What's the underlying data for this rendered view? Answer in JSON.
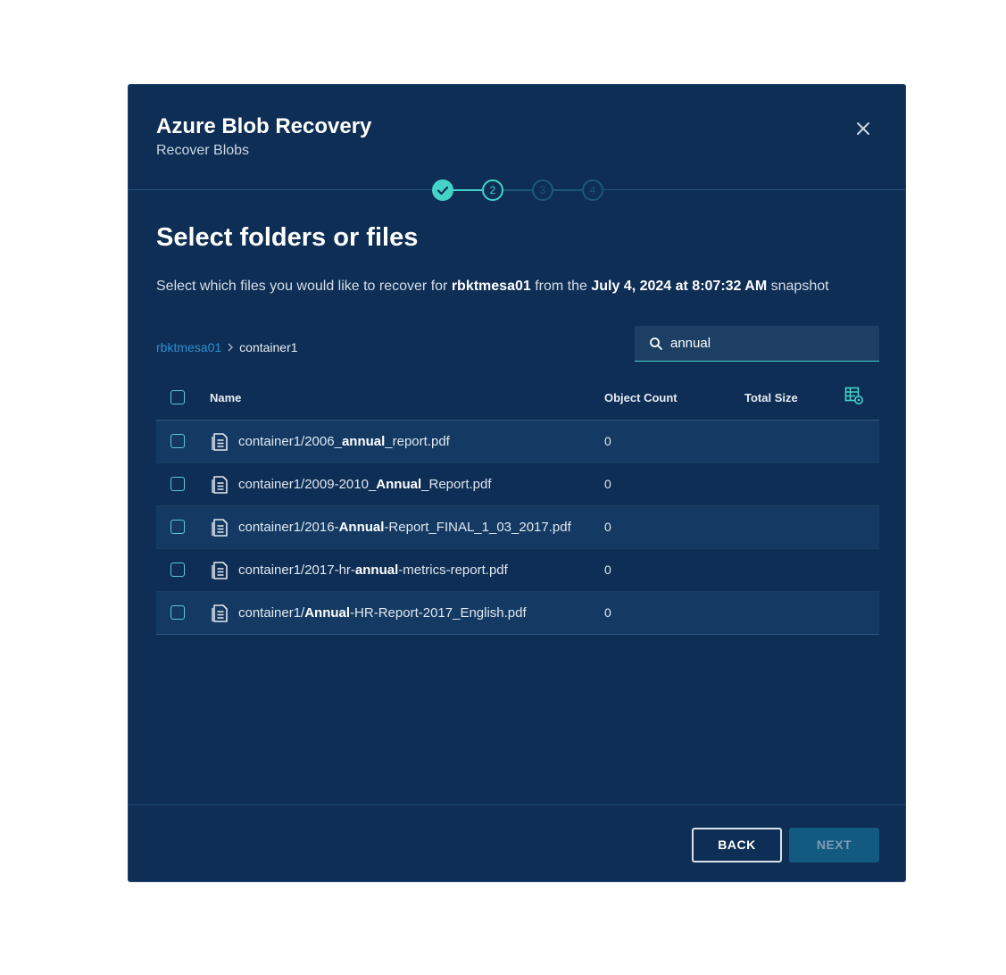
{
  "dialog": {
    "title": "Azure Blob Recovery",
    "subtitle": "Recover Blobs"
  },
  "stepper": {
    "steps": [
      {
        "label": "",
        "state": "done"
      },
      {
        "label": "2",
        "state": "active"
      },
      {
        "label": "3",
        "state": "future"
      },
      {
        "label": "4",
        "state": "future"
      }
    ]
  },
  "section": {
    "title": "Select folders or files",
    "description": {
      "prefix": "Select which files you would like to recover for ",
      "account": "rbktmesa01",
      "middle": " from the ",
      "snapshot": "July 4, 2024 at 8:07:32 AM",
      "suffix": " snapshot"
    }
  },
  "breadcrumb": {
    "root": "rbktmesa01",
    "current": "container1"
  },
  "search": {
    "value": "annual",
    "placeholder": "Search"
  },
  "table": {
    "columns": {
      "name": "Name",
      "object_count": "Object Count",
      "total_size": "Total Size"
    },
    "rows": [
      {
        "pre": "container1/2006_",
        "match": "annual",
        "post": "_report.pdf",
        "object_count": "0",
        "total_size": ""
      },
      {
        "pre": "container1/2009-2010_",
        "match": "Annual",
        "post": "_Report.pdf",
        "object_count": "0",
        "total_size": ""
      },
      {
        "pre": "container1/2016-",
        "match": "Annual",
        "post": "-Report_FINAL_1_03_2017.pdf",
        "object_count": "0",
        "total_size": ""
      },
      {
        "pre": "container1/2017-hr-",
        "match": "annual",
        "post": "-metrics-report.pdf",
        "object_count": "0",
        "total_size": ""
      },
      {
        "pre": "container1/",
        "match": "Annual",
        "post": "-HR-Report-2017_English.pdf",
        "object_count": "0",
        "total_size": ""
      }
    ]
  },
  "footer": {
    "back_label": "BACK",
    "next_label": "NEXT"
  },
  "colors": {
    "background": "#0e2e55",
    "accent": "#44d3c8",
    "link": "#2f8fd0"
  }
}
